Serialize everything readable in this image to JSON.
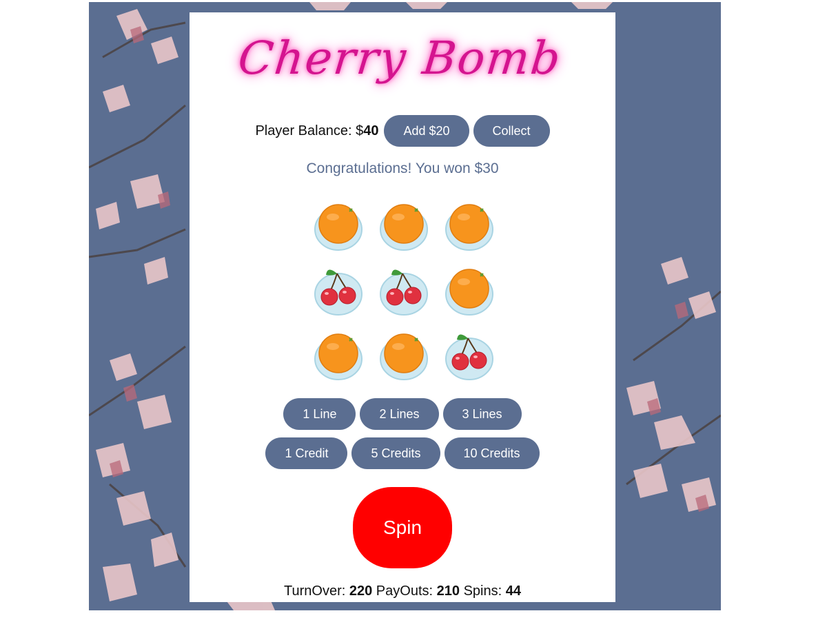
{
  "game": {
    "logo_text": "Cherry Bomb"
  },
  "balance": {
    "label": "Player Balance: $",
    "amount": "40",
    "add_label": "Add $20",
    "collect_label": "Collect"
  },
  "message": "Congratulations! You won $30",
  "reels": [
    [
      "orange",
      "orange",
      "orange"
    ],
    [
      "cherry",
      "cherry",
      "orange"
    ],
    [
      "orange",
      "orange",
      "cherry"
    ]
  ],
  "lines_buttons": [
    "1 Line",
    "2 Lines",
    "3 Lines"
  ],
  "credit_buttons": [
    "1 Credit",
    "5 Credits",
    "10 Credits"
  ],
  "spin_label": "Spin",
  "stats": {
    "turnover_label": "TurnOver:",
    "turnover": "220",
    "payouts_label": "PayOuts:",
    "payouts": "210",
    "spins_label": "Spins:",
    "spins": "44"
  },
  "colors": {
    "accent": "#5b6e91",
    "spin": "#ff0000",
    "logo": "#d4148f",
    "orange": "#f7941d",
    "cherry": "#e0313f"
  }
}
